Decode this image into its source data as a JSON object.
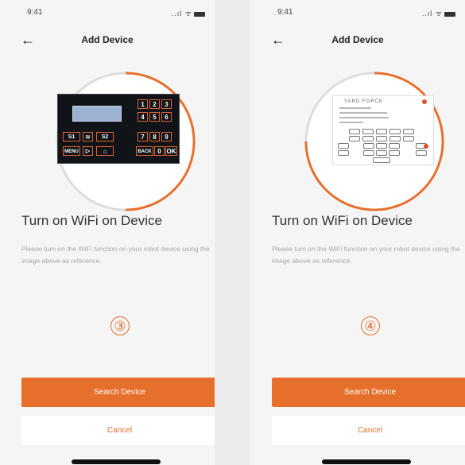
{
  "screens": [
    {
      "status_time": "9:41",
      "status_icons": "..ıl ᯤ",
      "nav_title": "Add Device",
      "back_icon": "←",
      "heading": "Turn on WiFi on Device",
      "description": "Please turn on the WiFi function on your robot device using the image above as reference.",
      "step_number": "③",
      "progress_fraction": 0.5,
      "primary_button": "Search Device",
      "secondary_button": "Cancel"
    },
    {
      "status_time": "9:41",
      "status_icons": "..ıl ᯤ",
      "nav_title": "Add Device",
      "back_icon": "←",
      "heading": "Turn on WiFi on Device",
      "description": "Please turn on the WiFi function on your robot device using the image above as reference.",
      "step_number": "④",
      "progress_fraction": 0.75,
      "primary_button": "Search Device",
      "secondary_button": "Cancel"
    }
  ],
  "keypad": {
    "digits": [
      "1",
      "2",
      "3",
      "4",
      "5",
      "6",
      "7",
      "8",
      "9",
      "0"
    ],
    "s1": "S1",
    "s2": "S2",
    "menu": "MENU",
    "back": "BACK",
    "ok": "OK"
  },
  "remote": {
    "brand": "YARD FORCE"
  },
  "colors": {
    "accent": "#e76f2c",
    "ring_track": "#dddddd",
    "background": "#f5f5f5"
  }
}
